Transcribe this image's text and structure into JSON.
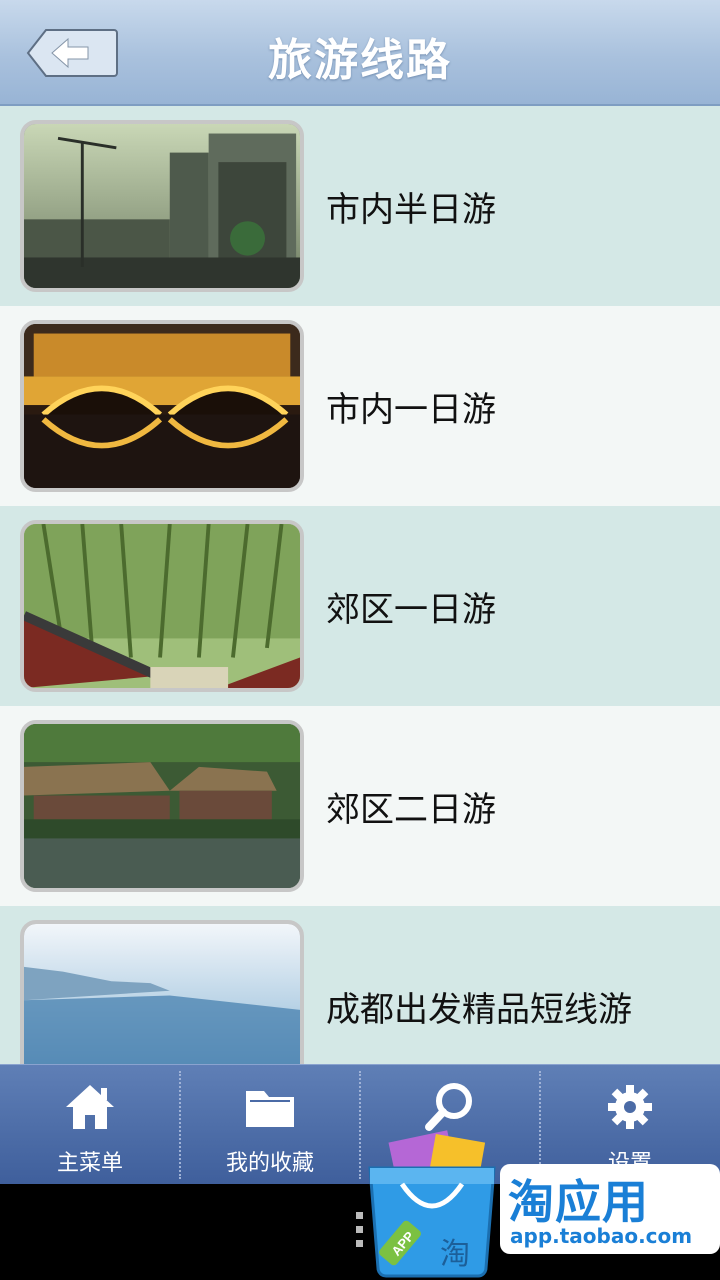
{
  "header": {
    "title": "旅游线路",
    "back_icon": "back-arrow-icon"
  },
  "routes": [
    {
      "label": "市内半日游",
      "image": "city-street-photo"
    },
    {
      "label": "市内一日游",
      "image": "night-bridge-photo"
    },
    {
      "label": "郊区一日游",
      "image": "bamboo-forest-photo"
    },
    {
      "label": "郊区二日游",
      "image": "thatched-houses-photo"
    },
    {
      "label": "成都出发精品短线游",
      "image": "misty-river-photo"
    }
  ],
  "tabbar": {
    "items": [
      {
        "label": "主菜单",
        "icon": "home-icon"
      },
      {
        "label": "我的收藏",
        "icon": "folder-icon"
      },
      {
        "label": "",
        "icon": "search-icon"
      },
      {
        "label": "设置",
        "icon": "gear-icon"
      }
    ]
  },
  "promo": {
    "title": "淘应用",
    "url": "app.taobao.com",
    "bag_text": "APP",
    "bag_char": "淘"
  },
  "colors": {
    "header": "#a9c1dd",
    "row_a": "#d4e8e6",
    "row_b": "#f3f7f6",
    "tabbar": "#4b6ba6",
    "promo_blue": "#1a7fd6"
  }
}
